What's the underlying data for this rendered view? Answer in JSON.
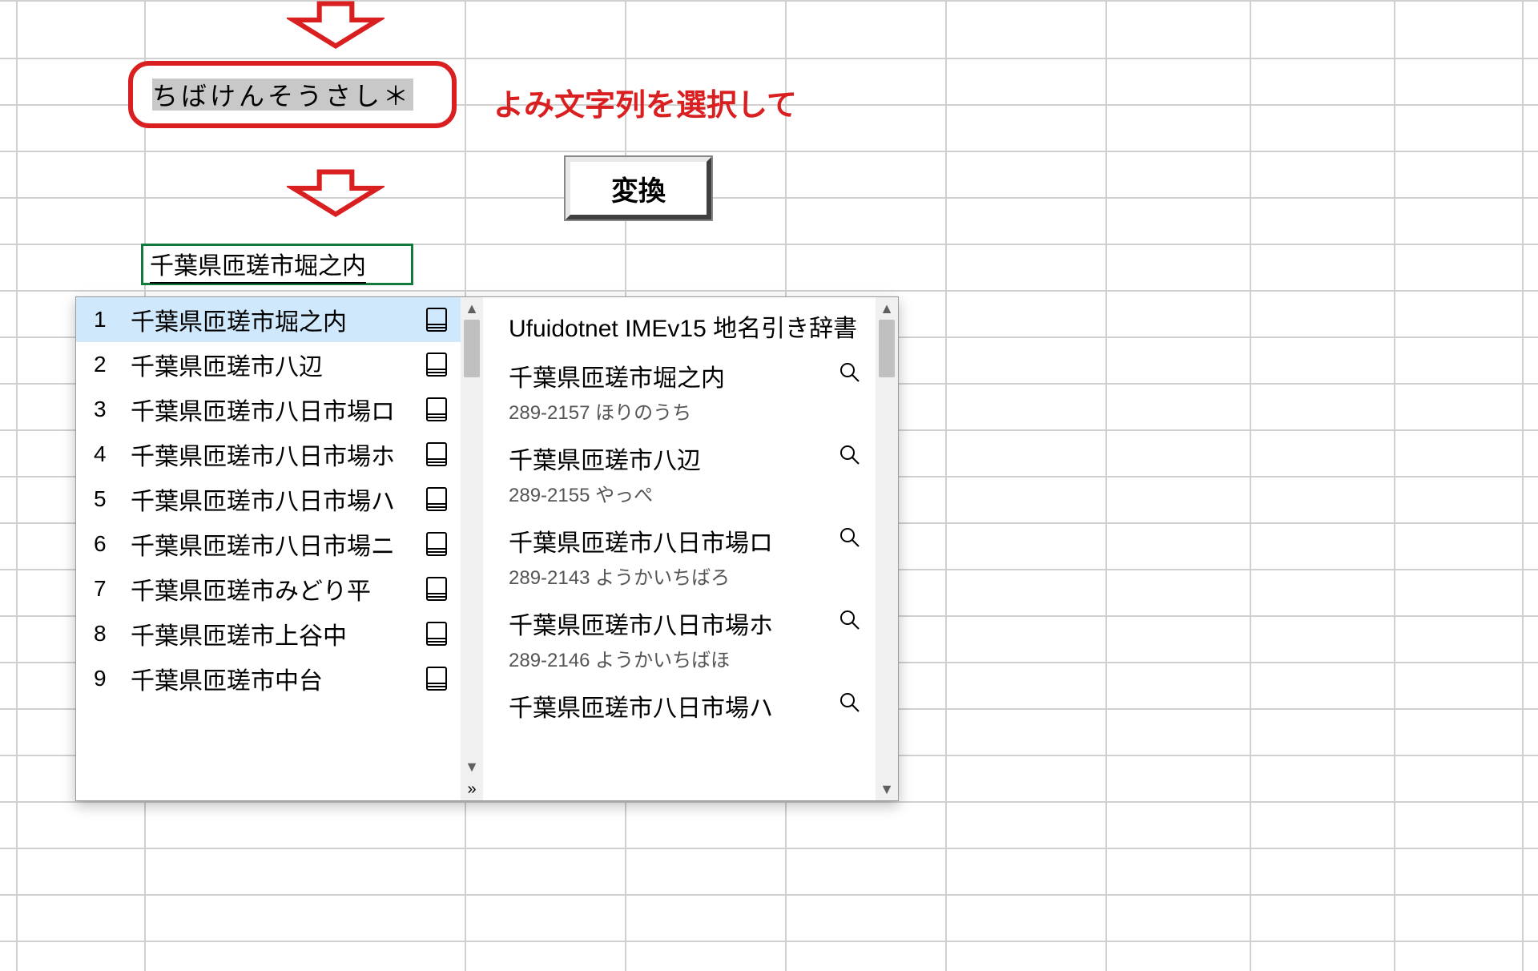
{
  "grid": {
    "cols": [
      20,
      180,
      580,
      780,
      980,
      1180,
      1380,
      1560,
      1740,
      1900
    ],
    "rows": [
      0,
      72,
      130,
      188,
      246,
      304,
      362,
      420,
      478,
      536,
      594,
      652,
      710,
      768,
      826,
      884,
      942,
      1000,
      1058,
      1116,
      1174
    ]
  },
  "input": {
    "hiragana": "ちばけんそうさし＊"
  },
  "callout": {
    "helper_text": "よみ文字列を選択して"
  },
  "button": {
    "label": "変換"
  },
  "active_cell": {
    "text": "千葉県匝瑳市堀之内"
  },
  "candidates": [
    {
      "n": "1",
      "text": "千葉県匝瑳市堀之内",
      "selected": true
    },
    {
      "n": "2",
      "text": "千葉県匝瑳市八辺",
      "selected": false
    },
    {
      "n": "3",
      "text": "千葉県匝瑳市八日市場ロ",
      "selected": false
    },
    {
      "n": "4",
      "text": "千葉県匝瑳市八日市場ホ",
      "selected": false
    },
    {
      "n": "5",
      "text": "千葉県匝瑳市八日市場ハ",
      "selected": false
    },
    {
      "n": "6",
      "text": "千葉県匝瑳市八日市場ニ",
      "selected": false
    },
    {
      "n": "7",
      "text": "千葉県匝瑳市みどり平",
      "selected": false
    },
    {
      "n": "8",
      "text": "千葉県匝瑳市上谷中",
      "selected": false
    },
    {
      "n": "9",
      "text": "千葉県匝瑳市中台",
      "selected": false
    }
  ],
  "detail": {
    "title": "Ufuidotnet IMEv15 地名引き辞書",
    "entries": [
      {
        "name": "千葉県匝瑳市堀之内",
        "sub": "289-2157 ほりのうち"
      },
      {
        "name": "千葉県匝瑳市八辺",
        "sub": "289-2155 やっぺ"
      },
      {
        "name": "千葉県匝瑳市八日市場ロ",
        "sub": "289-2143 ようかいちばろ"
      },
      {
        "name": "千葉県匝瑳市八日市場ホ",
        "sub": "289-2146 ようかいちばほ"
      },
      {
        "name": "千葉県匝瑳市八日市場ハ",
        "sub": ""
      }
    ]
  }
}
